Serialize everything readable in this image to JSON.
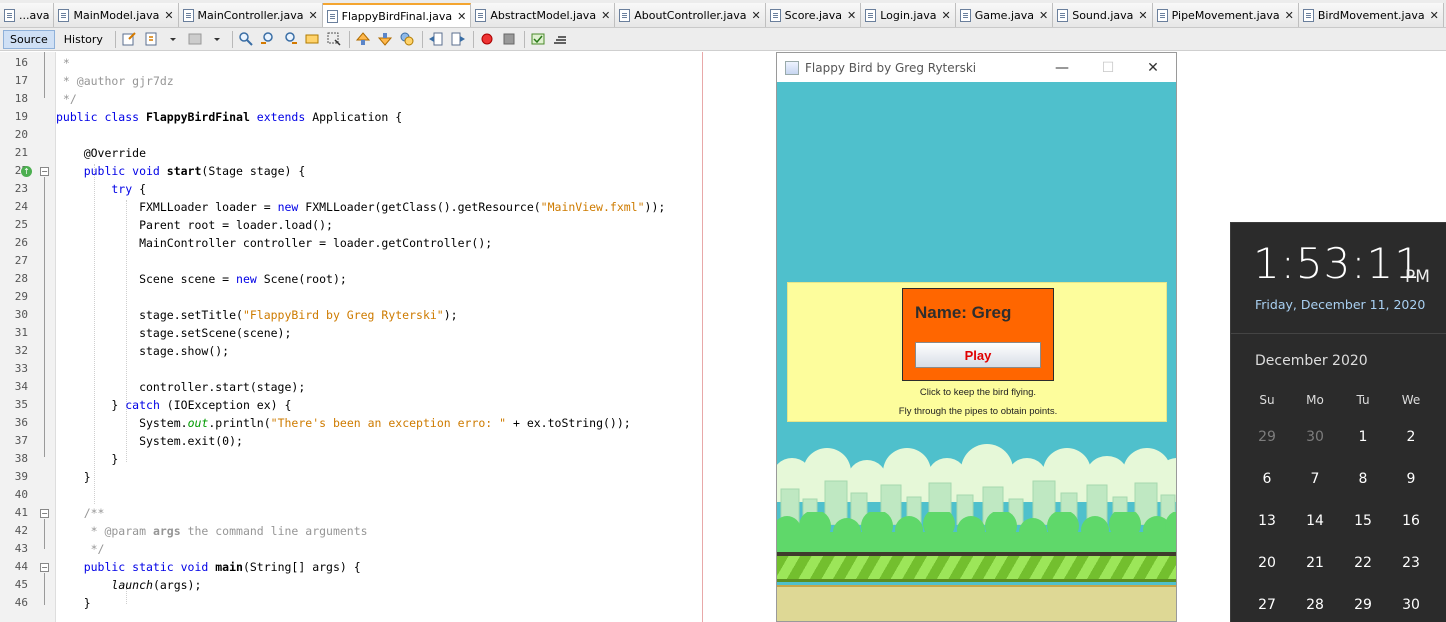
{
  "tabs": [
    {
      "label": "...ava",
      "active": false
    },
    {
      "label": "MainModel.java",
      "active": false
    },
    {
      "label": "MainController.java",
      "active": false
    },
    {
      "label": "FlappyBirdFinal.java",
      "active": true
    },
    {
      "label": "AbstractModel.java",
      "active": false
    },
    {
      "label": "AboutController.java",
      "active": false
    },
    {
      "label": "Score.java",
      "active": false
    },
    {
      "label": "Login.java",
      "active": false
    },
    {
      "label": "Game.java",
      "active": false
    },
    {
      "label": "Sound.java",
      "active": false
    },
    {
      "label": "PipeMovement.java",
      "active": false
    },
    {
      "label": "BirdMovement.java",
      "active": false
    }
  ],
  "tab_close": "✕",
  "toolbar": {
    "source_label": "Source",
    "history_label": "History"
  },
  "editor": {
    "line_numbers": [
      "16",
      "17",
      "18",
      "19",
      "20",
      "21",
      "22",
      "23",
      "24",
      "25",
      "26",
      "27",
      "28",
      "29",
      "30",
      "31",
      "32",
      "33",
      "34",
      "35",
      "36",
      "37",
      "38",
      "39",
      "40",
      "41",
      "42",
      "43",
      "44",
      "45",
      "46"
    ],
    "code": {
      "l16": " *",
      "l17a": " * @author ",
      "l17b": "gjr7dz",
      "l18": " */",
      "l19a": "public class ",
      "l19b": "FlappyBirdFinal",
      "l19c": " extends ",
      "l19d": "Application {",
      "l21": "    @Override",
      "l22a": "    public void ",
      "l22b": "start",
      "l22c": "(Stage stage) {",
      "l23a": "        try",
      "l23b": " {",
      "l24a": "            FXMLLoader loader = ",
      "l24b": "new",
      "l24c": " FXMLLoader(getClass().getResource(",
      "l24d": "\"MainView.fxml\"",
      "l24e": "));",
      "l25": "            Parent root = loader.load();",
      "l26": "            MainController controller = loader.getController();",
      "l28a": "            Scene scene = ",
      "l28b": "new",
      "l28c": " Scene(root);",
      "l30a": "            stage.setTitle(",
      "l30b": "\"FlappyBird by Greg Ryterski\"",
      "l30c": ");",
      "l31": "            stage.setScene(scene);",
      "l32": "            stage.show();",
      "l34": "            controller.start(stage);",
      "l35a": "        } ",
      "l35b": "catch",
      "l35c": " (IOException ex) {",
      "l36a": "            System.",
      "l36b": "out",
      "l36c": ".println(",
      "l36d": "\"There's been an exception erro: \"",
      "l36e": " + ex.toString());",
      "l37": "            System.exit(0);",
      "l38": "        }",
      "l39": "    }",
      "l41": "    /**",
      "l42a": "     * @param ",
      "l42b": "args",
      "l42c": " the command line arguments",
      "l43": "     */",
      "l44a": "    public static void ",
      "l44b": "main",
      "l44c": "(String[] args) {",
      "l45a": "        ",
      "l45b": "launch",
      "l45c": "(args);",
      "l46": "    }"
    }
  },
  "game_window": {
    "title": "Flappy Bird by Greg Ryterski",
    "minimize": "—",
    "maximize": "☐",
    "close": "✕",
    "name_label": "Name: Greg",
    "play_label": "Play",
    "hint1": "Click to keep the bird flying.",
    "hint2": "Fly through the pipes to obtain points."
  },
  "clock": {
    "time": "1:53:11",
    "ampm": "PM",
    "date": "Friday, December 11, 2020",
    "month": "December 2020",
    "weekdays": [
      "Su",
      "Mo",
      "Tu",
      "We"
    ],
    "weeks": [
      [
        "29",
        "30",
        "1",
        "2"
      ],
      [
        "6",
        "7",
        "8",
        "9"
      ],
      [
        "13",
        "14",
        "15",
        "16"
      ],
      [
        "20",
        "21",
        "22",
        "23"
      ],
      [
        "27",
        "28",
        "29",
        "30"
      ]
    ]
  }
}
